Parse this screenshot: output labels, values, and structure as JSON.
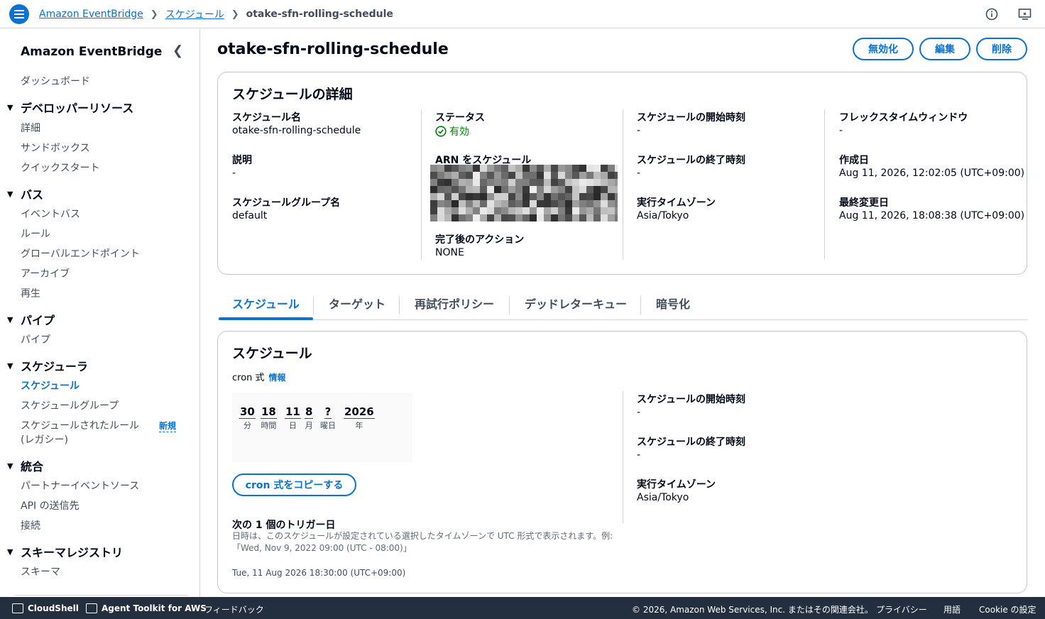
{
  "breadcrumbs": [
    {
      "label": "Amazon EventBridge"
    },
    {
      "label": "スケジュール"
    },
    {
      "label": "otake-sfn-rolling-schedule"
    }
  ],
  "top_icons": [
    "info-icon",
    "feedback-icon"
  ],
  "sidebar": {
    "title": "Amazon EventBridge",
    "dashboard": "ダッシュボード",
    "sections": [
      {
        "title": "デベロッパーリソース",
        "items": [
          "詳細",
          "サンドボックス",
          "クイックスタート"
        ]
      },
      {
        "title": "バス",
        "items": [
          "イベントバス",
          "ルール",
          "グローバルエンドポイント",
          "アーカイブ",
          "再生"
        ]
      },
      {
        "title": "パイプ",
        "items": [
          "パイプ"
        ]
      },
      {
        "title": "スケジューラ",
        "items": [
          "スケジュール",
          "スケジュールグループ",
          "スケジュールされたルール",
          "(レガシー)"
        ],
        "active": "スケジュール",
        "new_badge": "新規"
      },
      {
        "title": "統合",
        "items": [
          "パートナーイベントソース",
          "API の送信先",
          "接続"
        ]
      },
      {
        "title": "スキーマレジストリ",
        "items": [
          "スキーマ"
        ]
      }
    ]
  },
  "page": {
    "title": "otake-sfn-rolling-schedule",
    "buttons": {
      "disable": "無効化",
      "edit": "編集",
      "delete": "削除"
    }
  },
  "details": {
    "title": "スケジュールの詳細",
    "schedule_name_label": "スケジュール名",
    "schedule_name": "otake-sfn-rolling-schedule",
    "description_label": "説明",
    "description": "-",
    "group_label": "スケジュールグループ名",
    "group": "default",
    "status_label": "ステータス",
    "status": "有効",
    "arn_label": "ARN をスケジュール",
    "action_label": "完了後のアクション",
    "action": "NONE",
    "start_label": "スケジュールの開始時刻",
    "start": "-",
    "end_label": "スケジュールの終了時刻",
    "end": "-",
    "tz_label": "実行タイムゾーン",
    "tz": "Asia/Tokyo",
    "flex_label": "フレックスタイムウィンドウ",
    "flex": "-",
    "created_label": "作成日",
    "created": "Aug 11, 2026, 12:02:05 (UTC+09:00)",
    "modified_label": "最終変更日",
    "modified": "Aug 11, 2026, 18:08:38 (UTC+09:00)"
  },
  "tabs": [
    "スケジュール",
    "ターゲット",
    "再試行ポリシー",
    "デッドレターキュー",
    "暗号化"
  ],
  "schedule": {
    "title": "スケジュール",
    "cron_label": "cron 式",
    "info_link": "情報",
    "cron": [
      {
        "value": "30",
        "unit": "分"
      },
      {
        "value": "18",
        "unit": "時間"
      },
      {
        "value": "11",
        "unit": "日"
      },
      {
        "value": "8",
        "unit": "月"
      },
      {
        "value": "?",
        "unit": "曜日"
      },
      {
        "value": "2026",
        "unit": "年"
      }
    ],
    "copy_button": "cron 式をコピーする",
    "next_title": "次の 1 個のトリガー日",
    "next_desc_1": "日時は、このスケジュールが設定されている選択したタイムゾーンで UTC 形式で表示されます。例:",
    "next_desc_2": "「Wed, Nov 9, 2022 09:00 (UTC - 08:00)」",
    "next_date": "Tue, 11 Aug 2026 18:30:00 (UTC+09:00)",
    "start_label": "スケジュールの開始時刻",
    "start": "-",
    "end_label": "スケジュールの終了時刻",
    "end": "-",
    "tz_label": "実行タイムゾーン",
    "tz": "Asia/Tokyo"
  },
  "footer": {
    "cloudshell": "CloudShell",
    "agent_toolkit": "Agent Toolkit for AWS",
    "feedback": "フィードバック",
    "copyright": "© 2026, Amazon Web Services, Inc. またはその関連会社。",
    "privacy": "プライバシー",
    "terms": "用語",
    "cookie": "Cookie の設定"
  },
  "colors": {
    "accent": "#0972d3",
    "success": "#037f0c",
    "footer_bg": "#232f3e"
  }
}
